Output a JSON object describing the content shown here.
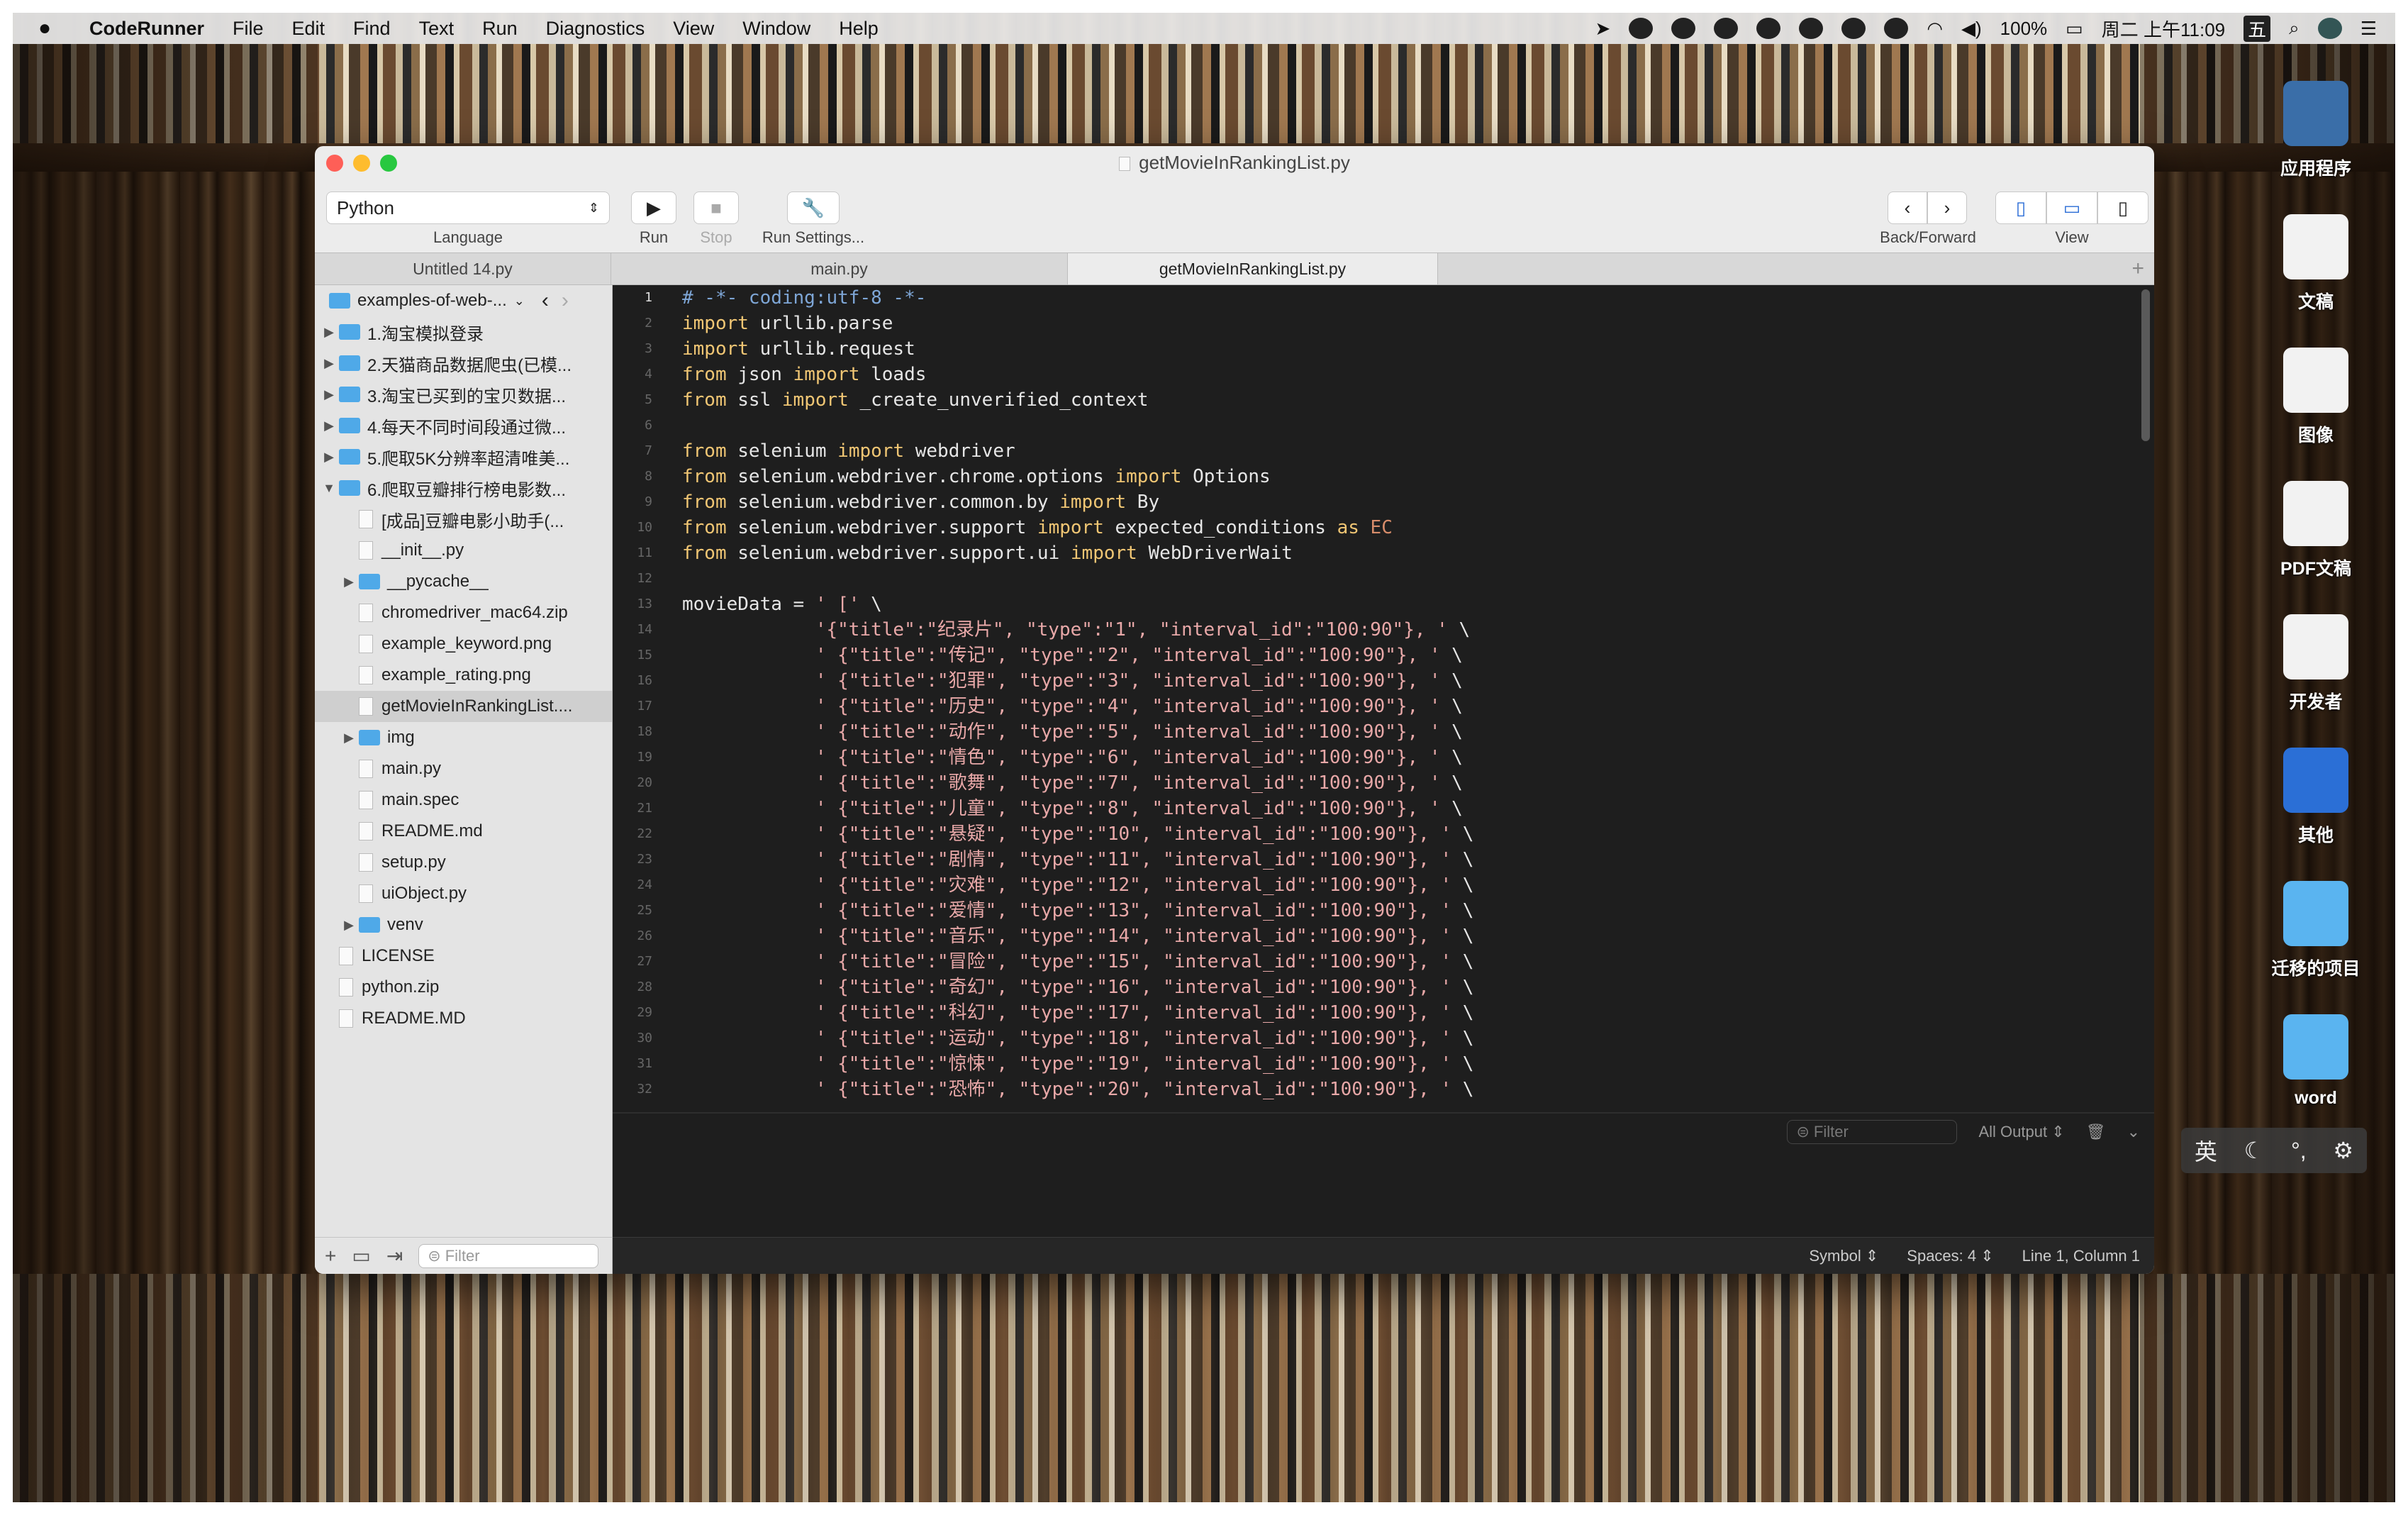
{
  "menubar": {
    "app": "CodeRunner",
    "items": [
      "File",
      "Edit",
      "Find",
      "Text",
      "Run",
      "Diagnostics",
      "View",
      "Window",
      "Help"
    ],
    "battery": "100%",
    "clock": "周二 上午11:09",
    "ime": "五"
  },
  "desktop": [
    {
      "label": "应用程序",
      "color": "#3a6ea8"
    },
    {
      "label": "文稿",
      "color": "#f2f2f2"
    },
    {
      "label": "图像",
      "color": "#f2f2f2"
    },
    {
      "label": "PDF文稿",
      "color": "#f2f2f2"
    },
    {
      "label": "开发者",
      "color": "#f2f2f2"
    },
    {
      "label": "其他",
      "color": "#2b6fd6"
    },
    {
      "label": "迁移的项目",
      "color": "#5ab4f0"
    },
    {
      "label": "word",
      "color": "#5ab4f0"
    }
  ],
  "window": {
    "title": "getMovieInRankingList.py",
    "toolbar": {
      "language": "Python",
      "language_label": "Language",
      "run_label": "Run",
      "stop_label": "Stop",
      "settings_label": "Run Settings...",
      "backforward_label": "Back/Forward",
      "view_label": "View"
    },
    "tabs": [
      "Untitled 14.py",
      "main.py",
      "getMovieInRankingList.py"
    ],
    "sidebar": {
      "project": "examples-of-web-...",
      "filter_placeholder": "Filter",
      "items": [
        {
          "label": "1.淘宝模拟登录",
          "kind": "folder",
          "depth": 0,
          "disc": "▶"
        },
        {
          "label": "2.天猫商品数据爬虫(已模...",
          "kind": "folder",
          "depth": 0,
          "disc": "▶"
        },
        {
          "label": "3.淘宝已买到的宝贝数据...",
          "kind": "folder",
          "depth": 0,
          "disc": "▶"
        },
        {
          "label": "4.每天不同时间段通过微...",
          "kind": "folder",
          "depth": 0,
          "disc": "▶"
        },
        {
          "label": "5.爬取5K分辨率超清唯美...",
          "kind": "folder",
          "depth": 0,
          "disc": "▶"
        },
        {
          "label": "6.爬取豆瓣排行榜电影数...",
          "kind": "folder",
          "depth": 0,
          "disc": "▼"
        },
        {
          "label": "[成品]豆瓣电影小助手(...",
          "kind": "file",
          "depth": 1,
          "disc": ""
        },
        {
          "label": "__init__.py",
          "kind": "file",
          "depth": 1,
          "disc": ""
        },
        {
          "label": "__pycache__",
          "kind": "folder",
          "depth": 1,
          "disc": "▶"
        },
        {
          "label": "chromedriver_mac64.zip",
          "kind": "file",
          "depth": 1,
          "disc": ""
        },
        {
          "label": "example_keyword.png",
          "kind": "file",
          "depth": 1,
          "disc": ""
        },
        {
          "label": "example_rating.png",
          "kind": "file",
          "depth": 1,
          "disc": ""
        },
        {
          "label": "getMovieInRankingList....",
          "kind": "file",
          "depth": 1,
          "disc": "",
          "selected": true
        },
        {
          "label": "img",
          "kind": "folder",
          "depth": 1,
          "disc": "▶"
        },
        {
          "label": "main.py",
          "kind": "file",
          "depth": 1,
          "disc": ""
        },
        {
          "label": "main.spec",
          "kind": "file",
          "depth": 1,
          "disc": ""
        },
        {
          "label": "README.md",
          "kind": "file",
          "depth": 1,
          "disc": ""
        },
        {
          "label": "setup.py",
          "kind": "file",
          "depth": 1,
          "disc": ""
        },
        {
          "label": "uiObject.py",
          "kind": "file",
          "depth": 1,
          "disc": ""
        },
        {
          "label": "venv",
          "kind": "folder",
          "depth": 1,
          "disc": "▶"
        },
        {
          "label": "LICENSE",
          "kind": "file",
          "depth": 0,
          "disc": ""
        },
        {
          "label": "python.zip",
          "kind": "file",
          "depth": 0,
          "disc": ""
        },
        {
          "label": "README.MD",
          "kind": "file",
          "depth": 0,
          "disc": ""
        }
      ]
    },
    "code": {
      "header": [
        [
          [
            "cm",
            "# -*- coding:utf-8 -*-"
          ]
        ],
        [
          [
            "kw",
            "import"
          ],
          [
            "",
            " urllib.parse"
          ]
        ],
        [
          [
            "kw",
            "import"
          ],
          [
            "",
            " urllib.request"
          ]
        ],
        [
          [
            "kw",
            "from"
          ],
          [
            "",
            " json "
          ],
          [
            "kw",
            "import"
          ],
          [
            "",
            " loads"
          ]
        ],
        [
          [
            "kw",
            "from"
          ],
          [
            "",
            " ssl "
          ],
          [
            "kw",
            "import"
          ],
          [
            "",
            " _create_unverified_context"
          ]
        ],
        [],
        [
          [
            "kw",
            "from"
          ],
          [
            "",
            " selenium "
          ],
          [
            "kw",
            "import"
          ],
          [
            "",
            " webdriver"
          ]
        ],
        [
          [
            "kw",
            "from"
          ],
          [
            "",
            " selenium.webdriver.chrome.options "
          ],
          [
            "kw",
            "import"
          ],
          [
            "",
            " Options"
          ]
        ],
        [
          [
            "kw",
            "from"
          ],
          [
            "",
            " selenium.webdriver.common.by "
          ],
          [
            "kw",
            "import"
          ],
          [
            "",
            " By"
          ]
        ],
        [
          [
            "kw",
            "from"
          ],
          [
            "",
            " selenium.webdriver.support "
          ],
          [
            "kw",
            "import"
          ],
          [
            "",
            " expected_conditions "
          ],
          [
            "kw",
            "as"
          ],
          [
            "ec",
            " EC"
          ]
        ],
        [
          [
            "kw",
            "from"
          ],
          [
            "",
            " selenium.webdriver.support.ui "
          ],
          [
            "kw",
            "import"
          ],
          [
            "",
            " WebDriverWait"
          ]
        ],
        [],
        [
          [
            "",
            "movieData = "
          ],
          [
            "st",
            "' ['"
          ],
          [
            "",
            " \\"
          ]
        ]
      ],
      "genres": [
        [
          "纪录片",
          "1"
        ],
        [
          "传记",
          "2"
        ],
        [
          "犯罪",
          "3"
        ],
        [
          "历史",
          "4"
        ],
        [
          "动作",
          "5"
        ],
        [
          "情色",
          "6"
        ],
        [
          "歌舞",
          "7"
        ],
        [
          "儿童",
          "8"
        ],
        [
          "悬疑",
          "10"
        ],
        [
          "剧情",
          "11"
        ],
        [
          "灾难",
          "12"
        ],
        [
          "爱情",
          "13"
        ],
        [
          "音乐",
          "14"
        ],
        [
          "冒险",
          "15"
        ],
        [
          "奇幻",
          "16"
        ],
        [
          "科幻",
          "17"
        ],
        [
          "运动",
          "18"
        ],
        [
          "惊悚",
          "19"
        ],
        [
          "恐怖",
          "20"
        ]
      ],
      "interval": "100:90"
    },
    "console": {
      "filter_placeholder": "Filter",
      "output_select": "All Output"
    },
    "statusbar": {
      "symbol": "Symbol",
      "spaces": "Spaces: 4",
      "position": "Line 1, Column 1"
    }
  },
  "ime_palette": {
    "lang": "英"
  }
}
